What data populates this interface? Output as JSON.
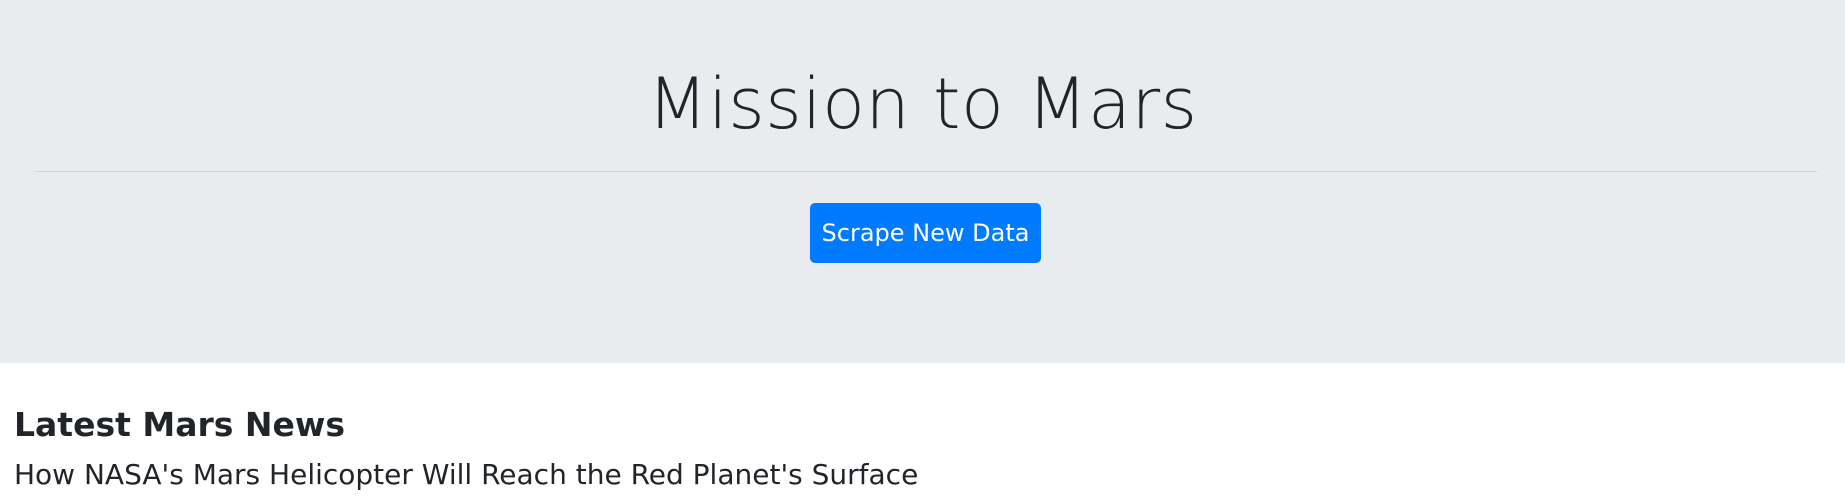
{
  "jumbotron": {
    "title": "Mission to Mars",
    "scrape_button_label": "Scrape New Data"
  },
  "news": {
    "heading": "Latest Mars News",
    "title": "How NASA's Mars Helicopter Will Reach the Red Planet's Surface"
  },
  "colors": {
    "jumbotron_bg": "#e9ecef",
    "button_primary": "#007bff",
    "text": "#212529"
  }
}
